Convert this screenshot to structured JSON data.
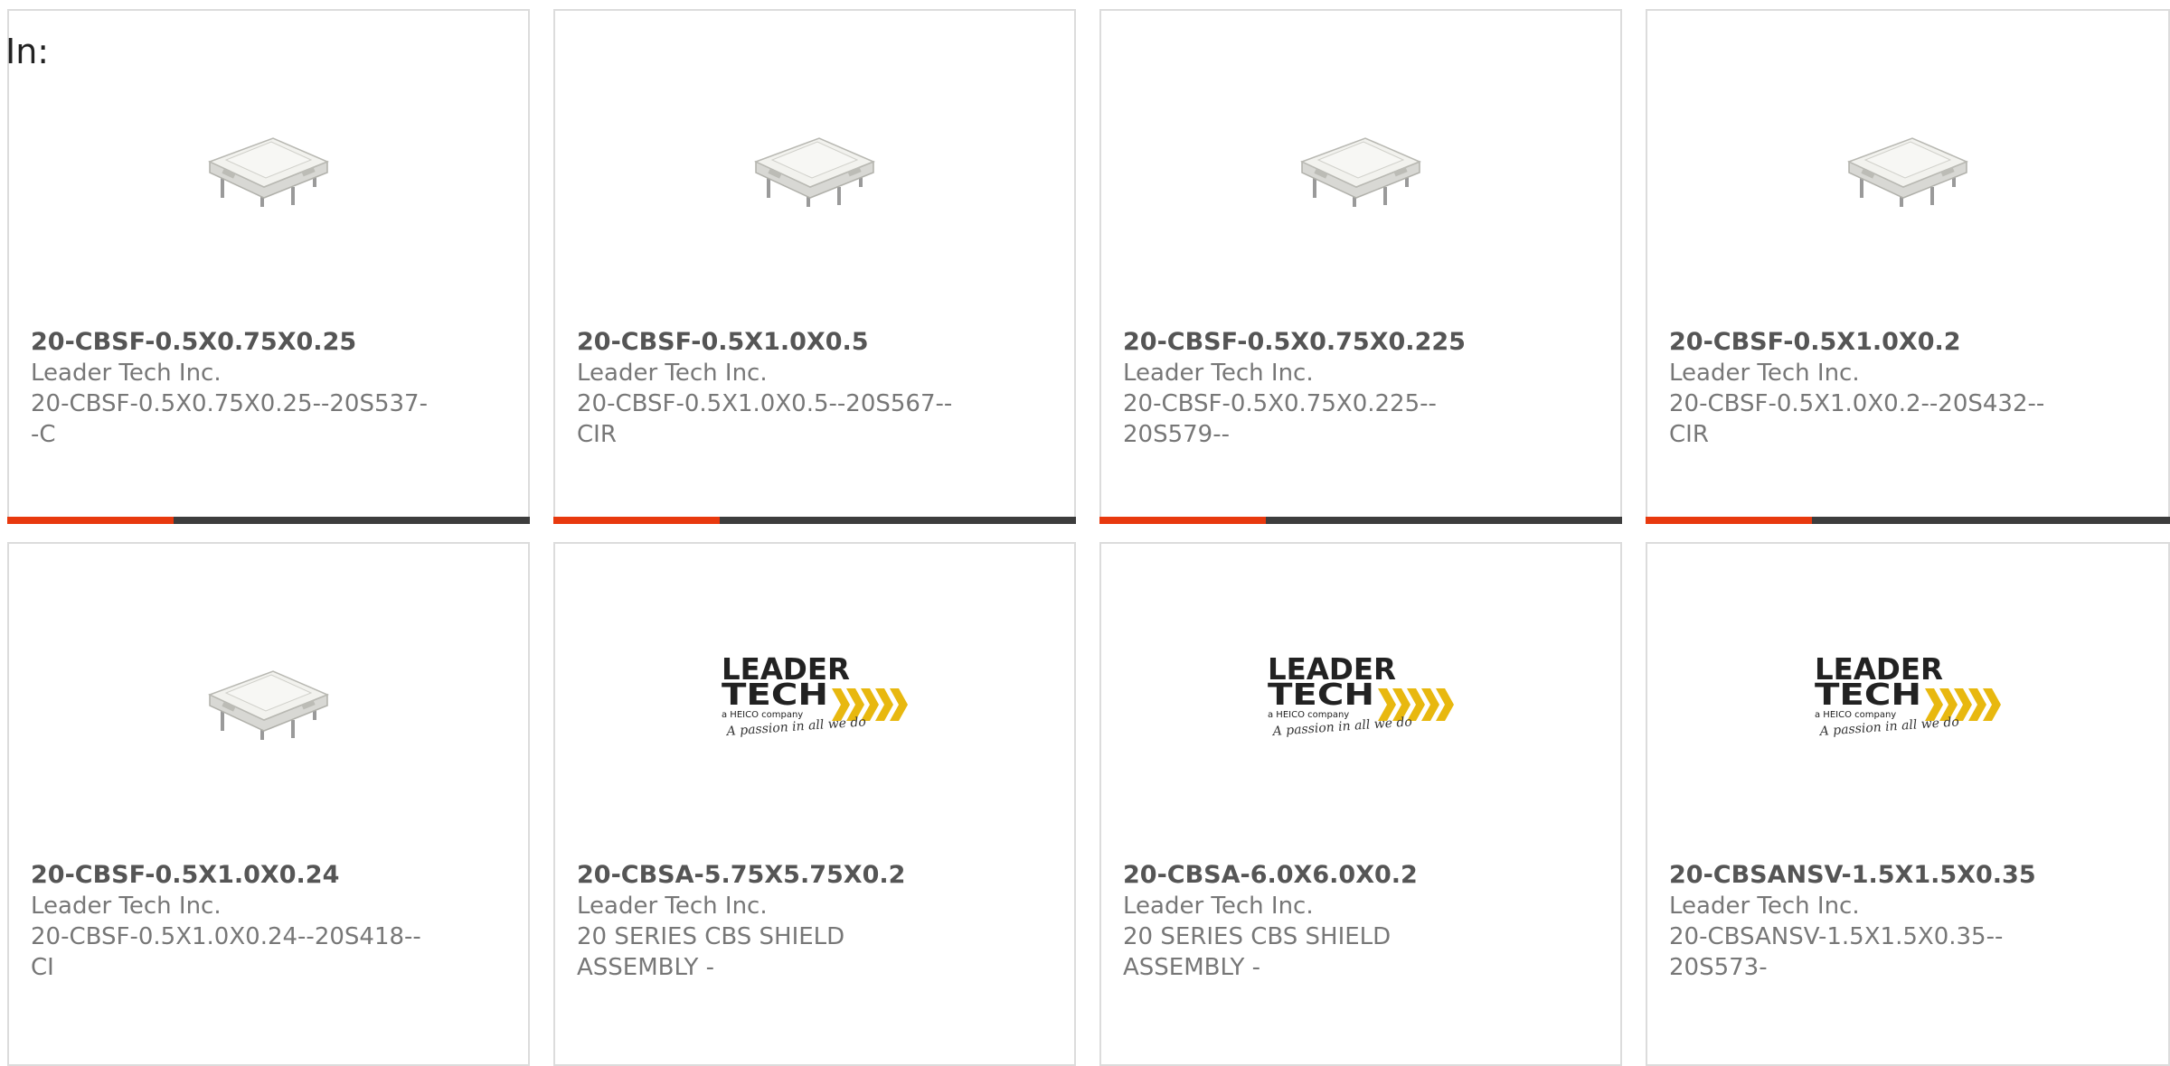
{
  "filter": {
    "label": "In:"
  },
  "colors": {
    "accent": "#e8390e",
    "bar": "#3d3d3d",
    "title": "#555555",
    "text": "#777777",
    "logo_gold": "#e8b80f"
  },
  "products": [
    {
      "part_number": "20-CBSF-0.5X0.75X0.25",
      "manufacturer": "Leader Tech Inc.",
      "description_lines": [
        "20-CBSF-0.5X0.75X0.25--20S537-",
        "-C"
      ],
      "image": "shield-product-photo",
      "accent_bar": true
    },
    {
      "part_number": "20-CBSF-0.5X1.0X0.5",
      "manufacturer": "Leader Tech Inc.",
      "description_lines": [
        "20-CBSF-0.5X1.0X0.5--20S567--",
        "CIR"
      ],
      "image": "shield-product-photo",
      "accent_bar": true
    },
    {
      "part_number": "20-CBSF-0.5X0.75X0.225",
      "manufacturer": "Leader Tech Inc.",
      "description_lines": [
        "20-CBSF-0.5X0.75X0.225--",
        "20S579--"
      ],
      "image": "shield-product-photo",
      "accent_bar": true
    },
    {
      "part_number": "20-CBSF-0.5X1.0X0.2",
      "manufacturer": "Leader Tech Inc.",
      "description_lines": [
        "20-CBSF-0.5X1.0X0.2--20S432--",
        "CIR"
      ],
      "image": "shield-product-photo",
      "accent_bar": true
    },
    {
      "part_number": "20-CBSF-0.5X1.0X0.24",
      "manufacturer": "Leader Tech Inc.",
      "description_lines": [
        "20-CBSF-0.5X1.0X0.24--20S418--",
        "CI"
      ],
      "image": "shield-product-photo",
      "accent_bar": false
    },
    {
      "part_number": "20-CBSA-5.75X5.75X0.2",
      "manufacturer": "Leader Tech Inc.",
      "description_lines": [
        "20 SERIES CBS SHIELD",
        "ASSEMBLY -"
      ],
      "image": "leader-tech-logo",
      "accent_bar": false
    },
    {
      "part_number": "20-CBSA-6.0X6.0X0.2",
      "manufacturer": "Leader Tech Inc.",
      "description_lines": [
        "20 SERIES CBS SHIELD",
        "ASSEMBLY -"
      ],
      "image": "leader-tech-logo",
      "accent_bar": false
    },
    {
      "part_number": "20-CBSANSV-1.5X1.5X0.35",
      "manufacturer": "Leader Tech Inc.",
      "description_lines": [
        "20-CBSANSV-1.5X1.5X0.35--",
        "20S573-"
      ],
      "image": "leader-tech-logo",
      "accent_bar": false
    }
  ],
  "logo": {
    "line1": "LEADER",
    "line2": "TECH",
    "tagline": "a HEICO company",
    "slogan": "A passion in all we do"
  }
}
